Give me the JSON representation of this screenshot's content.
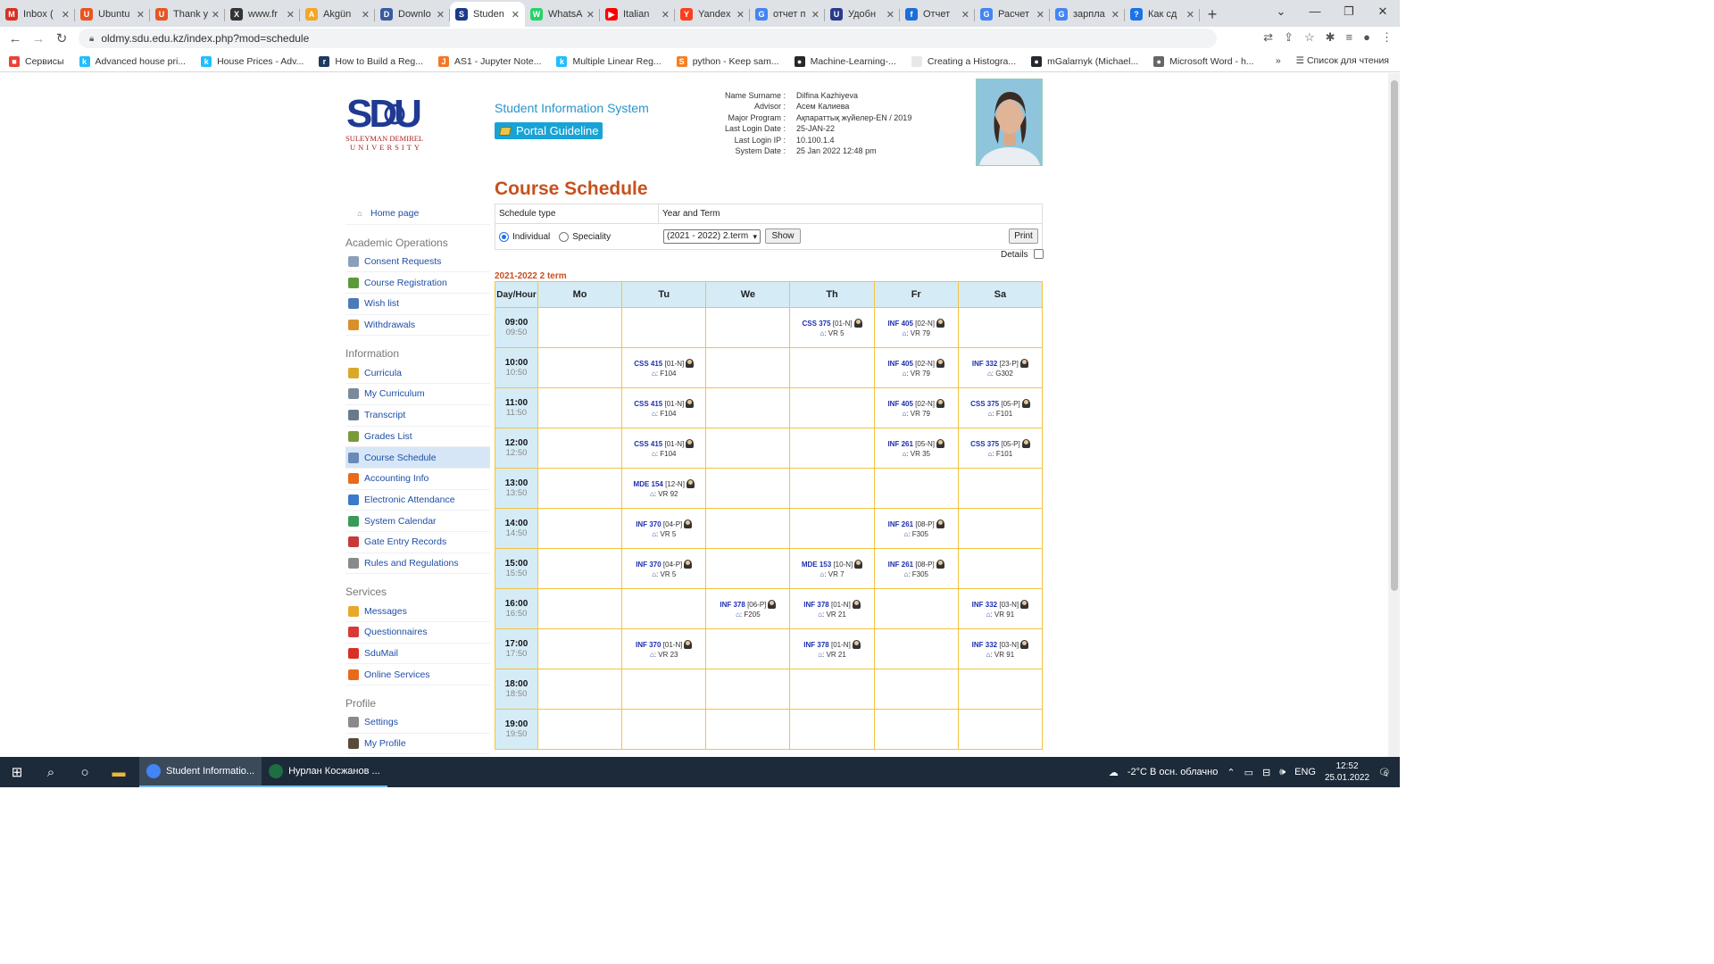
{
  "browser": {
    "tabs": [
      {
        "label": "Inbox (",
        "color": "#d93025",
        "glyph": "M"
      },
      {
        "label": "Ubuntu",
        "color": "#e95420",
        "glyph": "U"
      },
      {
        "label": "Thank y",
        "color": "#e95420",
        "glyph": "U"
      },
      {
        "label": "www.fr",
        "color": "#333333",
        "glyph": "X"
      },
      {
        "label": "Akgün",
        "color": "#f5a623",
        "glyph": "A"
      },
      {
        "label": "Downlo",
        "color": "#3a5ba0",
        "glyph": "D"
      },
      {
        "label": "Studen",
        "color": "#1a3a8a",
        "glyph": "S",
        "active": true
      },
      {
        "label": "WhatsA",
        "color": "#25d366",
        "glyph": "W"
      },
      {
        "label": "Italian",
        "color": "#ff0000",
        "glyph": "▶"
      },
      {
        "label": "Yandex",
        "color": "#fc3f1d",
        "glyph": "Y"
      },
      {
        "label": "отчет п",
        "color": "#4285f4",
        "glyph": "G"
      },
      {
        "label": "Удобн",
        "color": "#2b3a8c",
        "glyph": "U"
      },
      {
        "label": "Отчет",
        "color": "#1d6ed8",
        "glyph": "f"
      },
      {
        "label": "Расчет",
        "color": "#4285f4",
        "glyph": "G"
      },
      {
        "label": "зарпла",
        "color": "#4285f4",
        "glyph": "G"
      },
      {
        "label": "Как сд",
        "color": "#1a73e8",
        "glyph": "?"
      }
    ],
    "url": "oldmy.sdu.edu.kz/index.php?mod=schedule",
    "bookmarks": [
      {
        "label": "Сервисы",
        "color": "#ea4335",
        "glyph": "■"
      },
      {
        "label": "Advanced house pri...",
        "color": "#20beff",
        "glyph": "k"
      },
      {
        "label": "House Prices - Adv...",
        "color": "#20beff",
        "glyph": "k"
      },
      {
        "label": "How to Build a Reg...",
        "color": "#1f3a5f",
        "glyph": "r"
      },
      {
        "label": "AS1 - Jupyter Note...",
        "color": "#f37726",
        "glyph": "J"
      },
      {
        "label": "Multiple Linear Reg...",
        "color": "#20beff",
        "glyph": "k"
      },
      {
        "label": "python - Keep sam...",
        "color": "#f48024",
        "glyph": "S"
      },
      {
        "label": "Machine-Learning-...",
        "color": "#24292e",
        "glyph": "●"
      },
      {
        "label": "Creating a Histogra...",
        "color": "#e8e8e8",
        "glyph": " "
      },
      {
        "label": "mGalarnyk (Michael...",
        "color": "#24292e",
        "glyph": "●"
      },
      {
        "label": "Microsoft Word - h...",
        "color": "#666666",
        "glyph": "●"
      }
    ],
    "reading_list": "Список для чтения"
  },
  "header": {
    "logo_text": "SDU",
    "logo_sub1": "SULEYMAN DEMIREL",
    "logo_sub2": "UNIVERSITY",
    "sis_title": "Student Information System",
    "guide_label": "Portal Guideline"
  },
  "student": {
    "fields": [
      {
        "key": "Name Surname :",
        "value": "Dilfina Kazhiyeva"
      },
      {
        "key": "Advisor :",
        "value": "Асем Калиева"
      },
      {
        "key": "Major Program :",
        "value": "Ақпараттық жүйелер-EN / 2019"
      },
      {
        "key": "Last Login Date :",
        "value": "25-JAN-22"
      },
      {
        "key": "Last Login IP :",
        "value": "10.100.1.4"
      },
      {
        "key": "System Date :",
        "value": "25 Jan 2022 12:48 pm"
      }
    ]
  },
  "page_title": "Course Schedule",
  "sidebar": {
    "home": "Home page",
    "sections": [
      {
        "title": "Academic Operations",
        "items": [
          {
            "label": "Consent Requests",
            "icon": "clipboard-icon",
            "color": "#8aa0b8"
          },
          {
            "label": "Course Registration",
            "icon": "register-icon",
            "color": "#5a9a3a"
          },
          {
            "label": "Wish list",
            "icon": "wishlist-icon",
            "color": "#4a7ab8"
          },
          {
            "label": "Withdrawals",
            "icon": "withdraw-icon",
            "color": "#d9902a"
          }
        ]
      },
      {
        "title": "Information",
        "items": [
          {
            "label": "Curricula",
            "icon": "curricula-icon",
            "color": "#d9a82a"
          },
          {
            "label": "My Curriculum",
            "icon": "list-icon",
            "color": "#7a8a9a"
          },
          {
            "label": "Transcript",
            "icon": "transcript-icon",
            "color": "#6a7a8a"
          },
          {
            "label": "Grades List",
            "icon": "grades-icon",
            "color": "#7a9a3a"
          },
          {
            "label": "Course Schedule",
            "icon": "calendar-icon",
            "color": "#6a8ab8",
            "active": true
          },
          {
            "label": "Accounting Info",
            "icon": "accounting-icon",
            "color": "#e86a1a"
          },
          {
            "label": "Electronic Attendance",
            "icon": "attendance-icon",
            "color": "#3a7ac8"
          },
          {
            "label": "System Calendar",
            "icon": "calendar2-icon",
            "color": "#3a9a5a"
          },
          {
            "label": "Gate Entry Records",
            "icon": "gate-icon",
            "color": "#c83a3a"
          },
          {
            "label": "Rules and Regulations",
            "icon": "rules-icon",
            "color": "#8a8a8a"
          }
        ]
      },
      {
        "title": "Services",
        "items": [
          {
            "label": "Messages",
            "icon": "envelope-icon",
            "color": "#e8a82a"
          },
          {
            "label": "Questionnaires",
            "icon": "questionnaire-icon",
            "color": "#d83a3a"
          },
          {
            "label": "SduMail",
            "icon": "mail-icon",
            "color": "#d93025"
          },
          {
            "label": "Online Services",
            "icon": "online-icon",
            "color": "#e86a1a"
          }
        ]
      },
      {
        "title": "Profile",
        "items": [
          {
            "label": "Settings",
            "icon": "settings-icon",
            "color": "#8a8a8a"
          },
          {
            "label": "My Profile",
            "icon": "profile-icon",
            "color": "#5a4a3a"
          }
        ]
      }
    ]
  },
  "filter": {
    "schedule_type_label": "Schedule type",
    "year_term_label": "Year and Term",
    "opt_individual": "Individual",
    "opt_speciality": "Speciality",
    "term_select": "(2021 - 2022) 2.term",
    "show_label": "Show",
    "print_label": "Print",
    "details_label": "Details"
  },
  "term_heading": "2021-2022 2 term",
  "schedule": {
    "corner": "Day/Hour",
    "days": [
      "Mo",
      "Tu",
      "We",
      "Th",
      "Fr",
      "Sa"
    ],
    "rows": [
      {
        "start": "09:00",
        "end": "09:50",
        "cells": [
          null,
          null,
          null,
          {
            "code": "CSS 375",
            "grp": "[01-N]",
            "room": "VR 5"
          },
          {
            "code": "INF 405",
            "grp": "[02-N]",
            "room": "VR 79"
          },
          null
        ]
      },
      {
        "start": "10:00",
        "end": "10:50",
        "cells": [
          null,
          {
            "code": "CSS 415",
            "grp": "[01-N]",
            "room": "F104"
          },
          null,
          null,
          {
            "code": "INF 405",
            "grp": "[02-N]",
            "room": "VR 79"
          },
          {
            "code": "INF 332",
            "grp": "[23-P]",
            "room": "G302"
          }
        ]
      },
      {
        "start": "11:00",
        "end": "11:50",
        "cells": [
          null,
          {
            "code": "CSS 415",
            "grp": "[01-N]",
            "room": "F104"
          },
          null,
          null,
          {
            "code": "INF 405",
            "grp": "[02-N]",
            "room": "VR 79"
          },
          {
            "code": "CSS 375",
            "grp": "[05-P]",
            "room": "F101"
          }
        ]
      },
      {
        "start": "12:00",
        "end": "12:50",
        "cells": [
          null,
          {
            "code": "CSS 415",
            "grp": "[01-N]",
            "room": "F104"
          },
          null,
          null,
          {
            "code": "INF 261",
            "grp": "[05-N]",
            "room": "VR 35"
          },
          {
            "code": "CSS 375",
            "grp": "[05-P]",
            "room": "F101"
          }
        ]
      },
      {
        "start": "13:00",
        "end": "13:50",
        "cells": [
          null,
          {
            "code": "MDE 154",
            "grp": "[12-N]",
            "room": "VR 92"
          },
          null,
          null,
          null,
          null
        ]
      },
      {
        "start": "14:00",
        "end": "14:50",
        "cells": [
          null,
          {
            "code": "INF 370",
            "grp": "[04-P]",
            "room": "VR 5"
          },
          null,
          null,
          {
            "code": "INF 261",
            "grp": "[08-P]",
            "room": "F305"
          },
          null
        ]
      },
      {
        "start": "15:00",
        "end": "15:50",
        "cells": [
          null,
          {
            "code": "INF 370",
            "grp": "[04-P]",
            "room": "VR 5"
          },
          null,
          {
            "code": "MDE 153",
            "grp": "[10-N]",
            "room": "VR 7"
          },
          {
            "code": "INF 261",
            "grp": "[08-P]",
            "room": "F305"
          },
          null
        ]
      },
      {
        "start": "16:00",
        "end": "16:50",
        "cells": [
          null,
          null,
          {
            "code": "INF 378",
            "grp": "[06-P]",
            "room": "F205"
          },
          {
            "code": "INF 378",
            "grp": "[01-N]",
            "room": "VR 21"
          },
          null,
          {
            "code": "INF 332",
            "grp": "[03-N]",
            "room": "VR 91"
          }
        ]
      },
      {
        "start": "17:00",
        "end": "17:50",
        "cells": [
          null,
          {
            "code": "INF 370",
            "grp": "[01-N]",
            "room": "VR 23"
          },
          null,
          {
            "code": "INF 378",
            "grp": "[01-N]",
            "room": "VR 21"
          },
          null,
          {
            "code": "INF 332",
            "grp": "[03-N]",
            "room": "VR 91"
          }
        ]
      },
      {
        "start": "18:00",
        "end": "18:50",
        "cells": [
          null,
          null,
          null,
          null,
          null,
          null
        ]
      },
      {
        "start": "19:00",
        "end": "19:50",
        "cells": [
          null,
          null,
          null,
          null,
          null,
          null
        ]
      }
    ]
  },
  "taskbar": {
    "apps": [
      {
        "label": "Student Informatio...",
        "color": "#4285f4",
        "active": true
      },
      {
        "label": "Нурлан Косжанов ...",
        "color": "#1d6f42"
      }
    ],
    "weather": "-2°C  В осн. облачно",
    "lang": "ENG",
    "time": "12:52",
    "date": "25.01.2022",
    "notif_count": "6"
  }
}
